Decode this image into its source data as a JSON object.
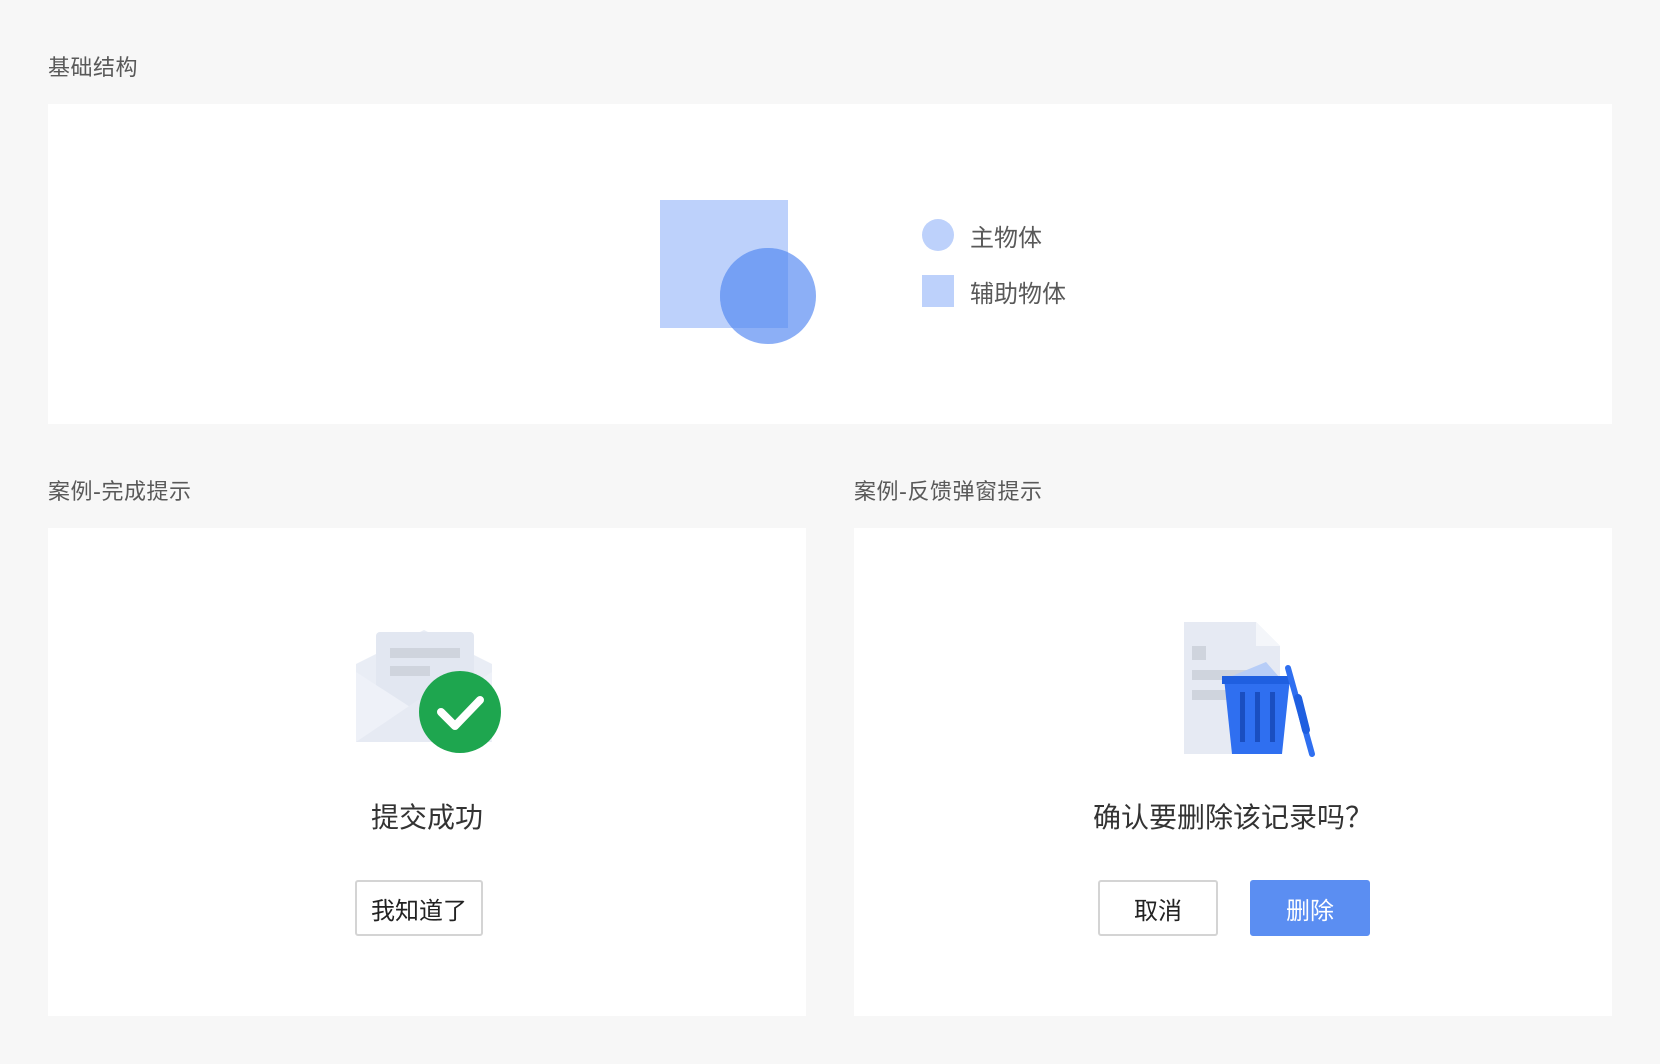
{
  "section_basic": {
    "title": "基础结构",
    "legend": [
      {
        "shape": "circle",
        "label": "主物体"
      },
      {
        "shape": "square",
        "label": "辅助物体"
      }
    ]
  },
  "section_complete": {
    "title": "案例-完成提示",
    "message": "提交成功",
    "icon": "envelope-check-icon",
    "button_label": "我知道了"
  },
  "section_feedback": {
    "title": "案例-反馈弹窗提示",
    "message": "确认要删除该记录吗？",
    "icon": "document-trash-icon",
    "cancel_label": "取消",
    "delete_label": "删除"
  },
  "colors": {
    "primary": "#5b8ef2",
    "light_primary": "#bdd1fb",
    "success": "#1ea64f",
    "trash": "#2f6ff0"
  }
}
